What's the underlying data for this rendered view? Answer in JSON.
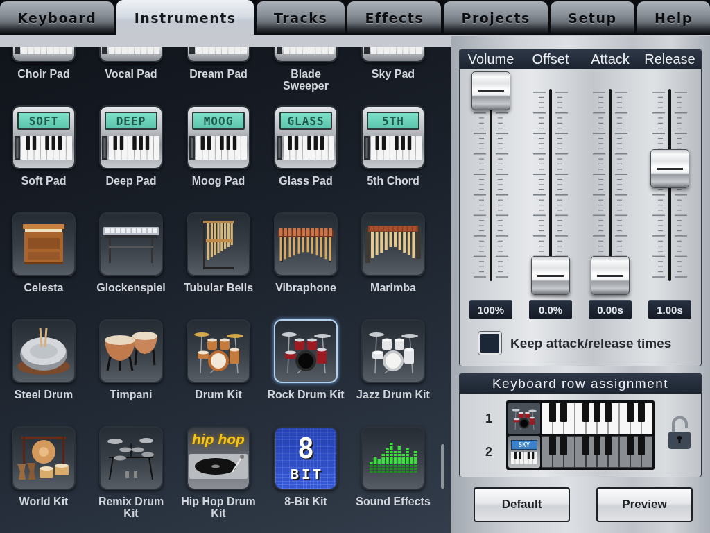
{
  "tabs": [
    {
      "label": "Keyboard",
      "selected": false
    },
    {
      "label": "Instruments",
      "selected": true
    },
    {
      "label": "Tracks",
      "selected": false
    },
    {
      "label": "Effects",
      "selected": false
    },
    {
      "label": "Projects",
      "selected": false
    },
    {
      "label": "Setup",
      "selected": false
    },
    {
      "label": "Help",
      "selected": false
    }
  ],
  "instrument_rows": [
    {
      "items": [
        {
          "label": "Choir Pad",
          "kind": "synth",
          "selected": false
        },
        {
          "label": "Vocal Pad",
          "kind": "synth",
          "selected": false
        },
        {
          "label": "Dream Pad",
          "kind": "synth",
          "selected": false
        },
        {
          "label": "Blade Sweeper",
          "kind": "synth",
          "selected": false
        },
        {
          "label": "Sky Pad",
          "kind": "synth",
          "selected": false
        }
      ]
    },
    {
      "items": [
        {
          "label": "Soft Pad",
          "kind": "synth",
          "display": "SOFT",
          "selected": false
        },
        {
          "label": "Deep Pad",
          "kind": "synth",
          "display": "DEEP",
          "selected": false
        },
        {
          "label": "Moog Pad",
          "kind": "synth",
          "display": "MOOG",
          "selected": false
        },
        {
          "label": "Glass Pad",
          "kind": "synth",
          "display": "GLASS",
          "selected": false
        },
        {
          "label": "5th Chord",
          "kind": "synth",
          "display": "5TH",
          "selected": false
        }
      ]
    },
    {
      "items": [
        {
          "label": "Celesta",
          "kind": "celesta",
          "selected": false
        },
        {
          "label": "Glockenspiel",
          "kind": "glockenspiel",
          "selected": false
        },
        {
          "label": "Tubular Bells",
          "kind": "chimes",
          "selected": false
        },
        {
          "label": "Vibraphone",
          "kind": "vibraphone",
          "selected": false
        },
        {
          "label": "Marimba",
          "kind": "marimba",
          "selected": false
        }
      ]
    },
    {
      "items": [
        {
          "label": "Steel Drum",
          "kind": "steeldrum",
          "selected": false
        },
        {
          "label": "Timpani",
          "kind": "timpani",
          "selected": false
        },
        {
          "label": "Drum Kit",
          "kind": "drumkit",
          "selected": false
        },
        {
          "label": "Rock Drum Kit",
          "kind": "rockkit",
          "selected": true
        },
        {
          "label": "Jazz Drum Kit",
          "kind": "jazzkit",
          "selected": false
        }
      ]
    },
    {
      "items": [
        {
          "label": "World Kit",
          "kind": "worldkit",
          "selected": false
        },
        {
          "label": "Remix Drum Kit",
          "kind": "remixkit",
          "selected": false
        },
        {
          "label": "Hip Hop Drum Kit",
          "kind": "hiphop",
          "art_text": [
            "hip hop"
          ],
          "selected": false
        },
        {
          "label": "8-Bit Kit",
          "kind": "eightbit",
          "art_text": [
            "8",
            "BIT"
          ],
          "selected": false
        },
        {
          "label": "Sound Effects",
          "kind": "effects",
          "selected": false
        }
      ]
    }
  ],
  "sliders": [
    {
      "label": "Volume",
      "level": 1,
      "reading": "100%"
    },
    {
      "label": "Offset",
      "level": 0,
      "reading": "0.0%"
    },
    {
      "label": "Attack",
      "level": 0,
      "reading": "0.00s"
    },
    {
      "label": "Release",
      "level": 0.58,
      "reading": "1.00s"
    }
  ],
  "keep_times": {
    "label": "Keep attack/release times",
    "checked": false
  },
  "keyboard_rows": {
    "title": "Keyboard row assignment",
    "locked": false,
    "rows": [
      {
        "number": "1",
        "kind": "rockkit",
        "selected": true
      },
      {
        "number": "2",
        "kind": "synth",
        "display": "SKY",
        "selected": false
      }
    ]
  },
  "buttons": [
    "Default",
    "Preview"
  ]
}
